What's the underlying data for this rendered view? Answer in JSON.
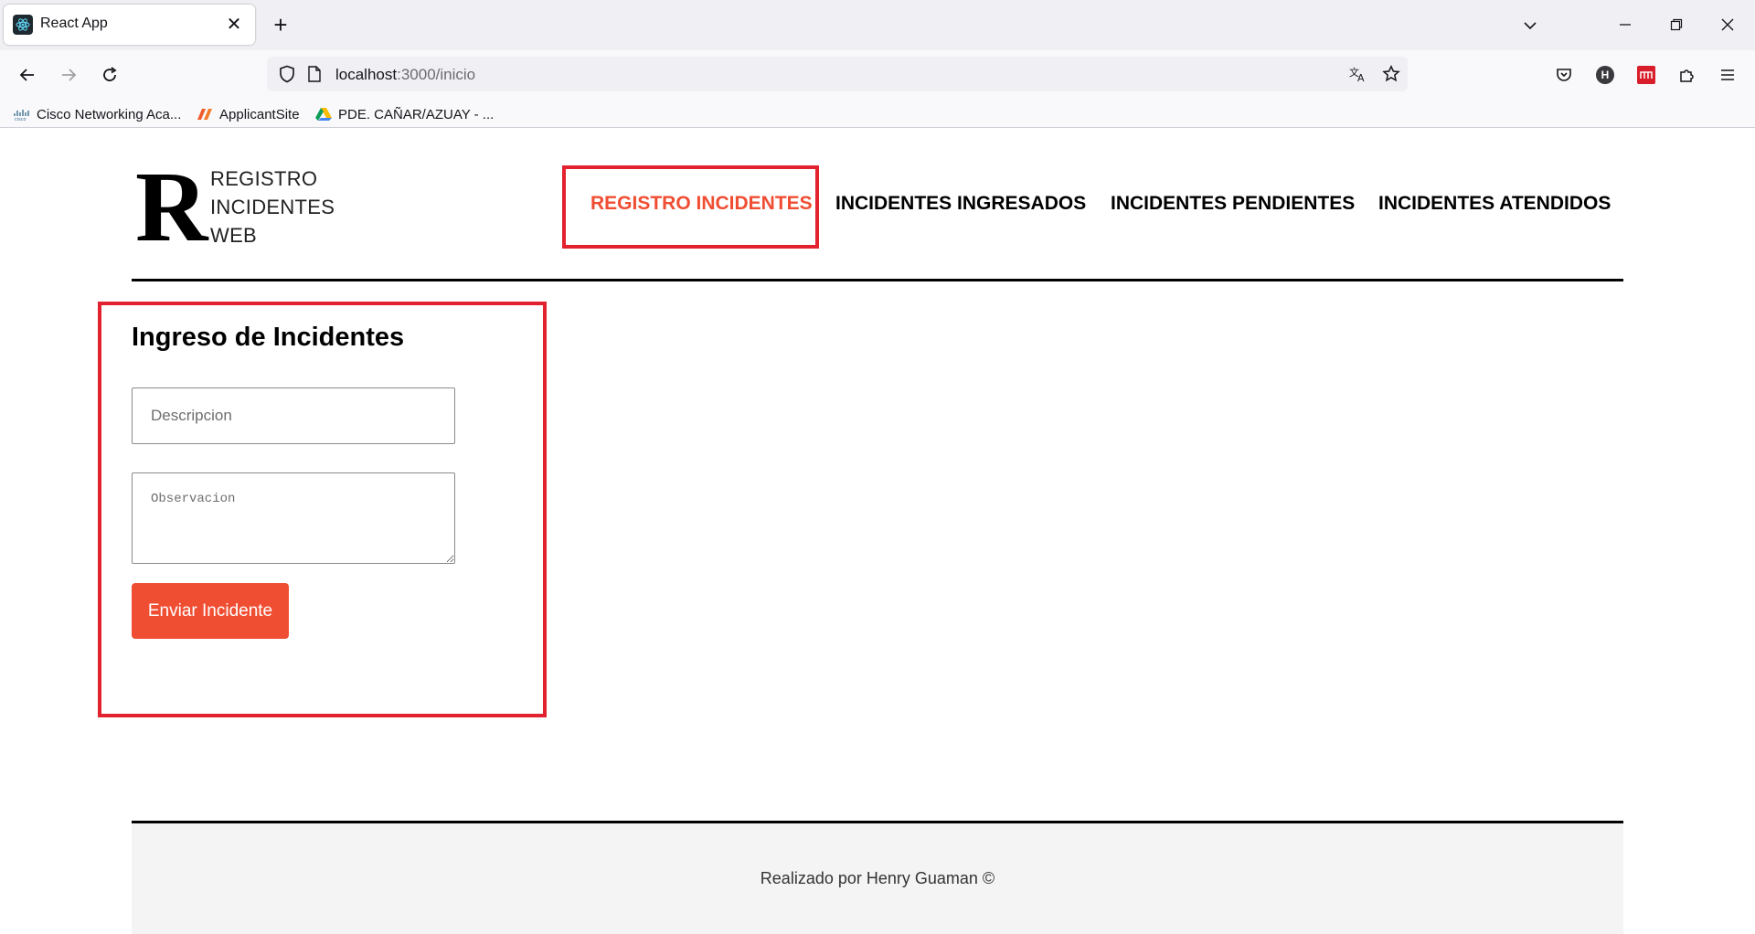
{
  "browser": {
    "tab_title": "React App",
    "tab_close": "✕",
    "new_tab": "+",
    "url_host": "localhost",
    "url_path": ":3000/inicio",
    "bookmarks": [
      {
        "label": "Cisco Networking Aca..."
      },
      {
        "label": "ApplicantSite"
      },
      {
        "label": "PDE. CAÑAR/AZUAY - ..."
      }
    ],
    "profile_initial": "H"
  },
  "logo": {
    "letter": "R",
    "line1": "REGISTRO",
    "line2": "INCIDENTES",
    "line3": "WEB"
  },
  "nav": {
    "items": [
      {
        "label": "REGISTRO INCIDENTES",
        "active": true
      },
      {
        "label": "INCIDENTES INGRESADOS",
        "active": false
      },
      {
        "label": "INCIDENTES PENDIENTES",
        "active": false
      },
      {
        "label": "INCIDENTES ATENDIDOS",
        "active": false
      }
    ]
  },
  "form": {
    "title": "Ingreso de Incidentes",
    "description_placeholder": "Descripcion",
    "description_value": "",
    "observation_placeholder": "Observacion",
    "observation_value": "",
    "submit_label": "Enviar Incidente"
  },
  "footer": {
    "text": "Realizado por Henry Guaman ©"
  },
  "colors": {
    "accent": "#f04e33",
    "highlight_box": "#e3222f"
  }
}
